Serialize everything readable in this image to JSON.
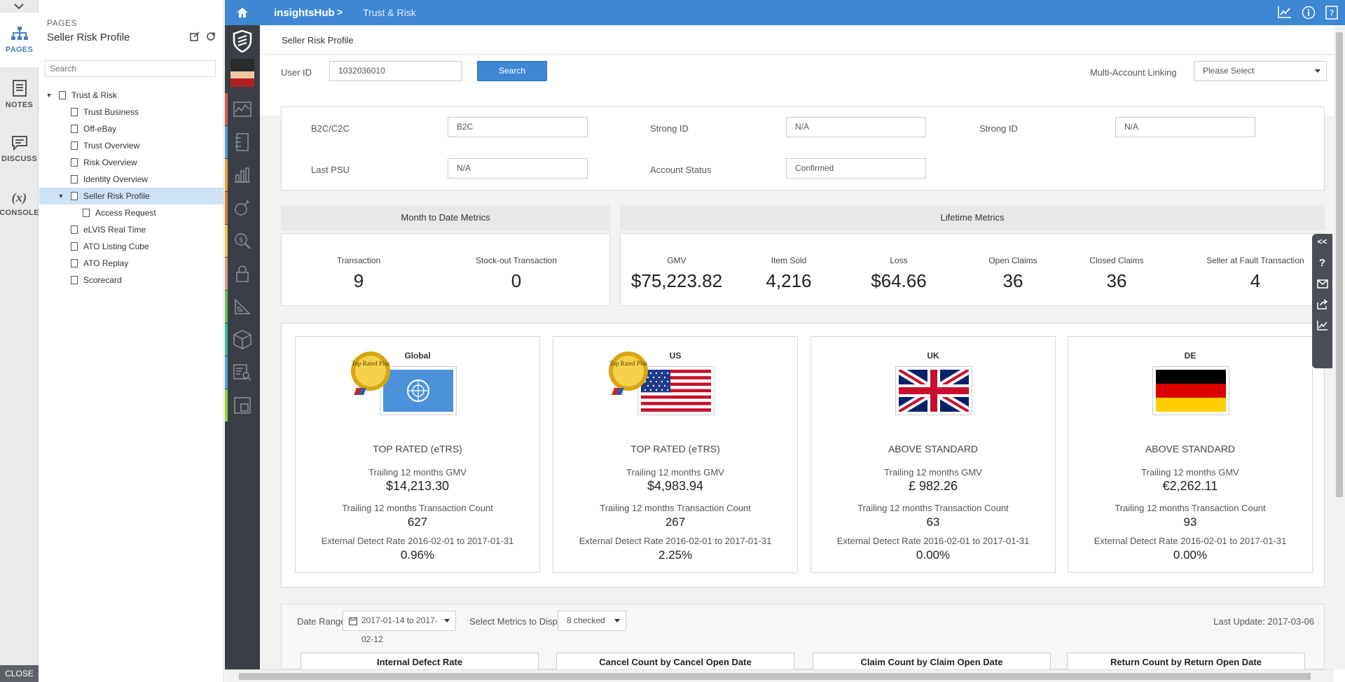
{
  "rail": {
    "pages_label": "PAGES",
    "notes_label": "NOTES",
    "discuss_label": "DISCUSS",
    "console_label": "CONSOLE",
    "close_label": "CLOSE"
  },
  "pages_panel": {
    "section": "PAGES",
    "title": "Seller Risk Profile",
    "search_placeholder": "Search",
    "tree": [
      "Trust & Risk",
      "Trust Business",
      "Off-eBay",
      "Trust Overview",
      "Risk Overview",
      "Identity Overview",
      "Seller Risk Profile",
      "Access Request",
      "eLVIS Real Time",
      "ATO Listing Cube",
      "ATO Replay",
      "Scorecard"
    ]
  },
  "header": {
    "app": "insightsHub",
    "separator": ">",
    "page": "Trust & Risk"
  },
  "page_title": "Seller Risk Profile",
  "user_search": {
    "user_id_label": "User ID",
    "user_id_value": "1032036010",
    "search_button": "Search",
    "linking_label": "Multi-Account Linking",
    "linking_value": "Please Select"
  },
  "account": {
    "b2c_label": "B2C/C2C",
    "b2c_value": "B2C",
    "strong_id_label_1": "Strong ID",
    "strong_id_value_1": "N/A",
    "strong_id_label_2": "Strong ID",
    "strong_id_value_2": "N/A",
    "last_psu_label": "Last PSU",
    "last_psu_value": "N/A",
    "status_label": "Account Status",
    "status_value": "Confirmed"
  },
  "mtd": {
    "title": "Month to Date Metrics",
    "items": [
      {
        "label": "Transaction",
        "value": "9"
      },
      {
        "label": "Stock-out Transaction",
        "value": "0"
      }
    ]
  },
  "lifetime": {
    "title": "Lifetime Metrics",
    "items": [
      {
        "label": "GMV",
        "value": "$75,223.82"
      },
      {
        "label": "Item Sold",
        "value": "4,216"
      },
      {
        "label": "Loss",
        "value": "$64.66"
      },
      {
        "label": "Open Claims",
        "value": "36"
      },
      {
        "label": "Closed Claims",
        "value": "36"
      },
      {
        "label": "Seller at Fault Transaction",
        "value": "4"
      }
    ]
  },
  "sites": [
    {
      "name": "Global",
      "badge": "Top Rated Plus",
      "rating": "TOP RATED (eTRS)",
      "gmv_label": "Trailing 12 months GMV",
      "gmv": "$14,213.30",
      "count_label": "Trailing 12 months Transaction Count",
      "count": "627",
      "rate_label": "External Detect Rate 2016-02-01 to 2017-01-31",
      "rate": "0.96%"
    },
    {
      "name": "US",
      "badge": "Top Rated Plus",
      "rating": "TOP RATED (eTRS)",
      "gmv_label": "Trailing 12 months GMV",
      "gmv": "$4,983.94",
      "count_label": "Trailing 12 months Transaction Count",
      "count": "267",
      "rate_label": "External Detect Rate 2016-02-01 to 2017-01-31",
      "rate": "2.25%"
    },
    {
      "name": "UK",
      "rating": "ABOVE STANDARD",
      "gmv_label": "Trailing 12 months GMV",
      "gmv": "£ 982.26",
      "count_label": "Trailing 12 months Transaction Count",
      "count": "63",
      "rate_label": "External Detect Rate 2016-02-01 to 2017-01-31",
      "rate": "0.00%"
    },
    {
      "name": "DE",
      "rating": "ABOVE STANDARD",
      "gmv_label": "Trailing 12 months GMV",
      "gmv": "€2,262.11",
      "count_label": "Trailing 12 months Transaction Count",
      "count": "93",
      "rate_label": "External Detect Rate 2016-02-01 to 2017-01-31",
      "rate": "0.00%"
    }
  ],
  "filters": {
    "date_label": "Date Range",
    "date_value": "2017-01-14 to 2017-02-12",
    "metrics_label": "Select Metrics to Display",
    "metrics_value": "8 checked",
    "last_update": "Last Update: 2017-03-06"
  },
  "chart_tabs": [
    "Internal Defect Rate",
    "Cancel Count by Cancel Open Date",
    "Claim Count by Claim Open Date",
    "Return Count by Return Open Date"
  ],
  "side_tools": {
    "collapse": "<<",
    "help": "?"
  },
  "colors": {
    "header_blue": "#3d87d3",
    "strip_dark": "#3a3f47",
    "selected_row": "#cfe3f6",
    "strip_accents": [
      "#e05a47",
      "#5a9be0",
      "#f0a030",
      "#e07a30",
      "#f0c040",
      "#d9a07a",
      "#6abf5a",
      "#3cbca0",
      "#4aa8e0",
      "#9acd32"
    ]
  }
}
